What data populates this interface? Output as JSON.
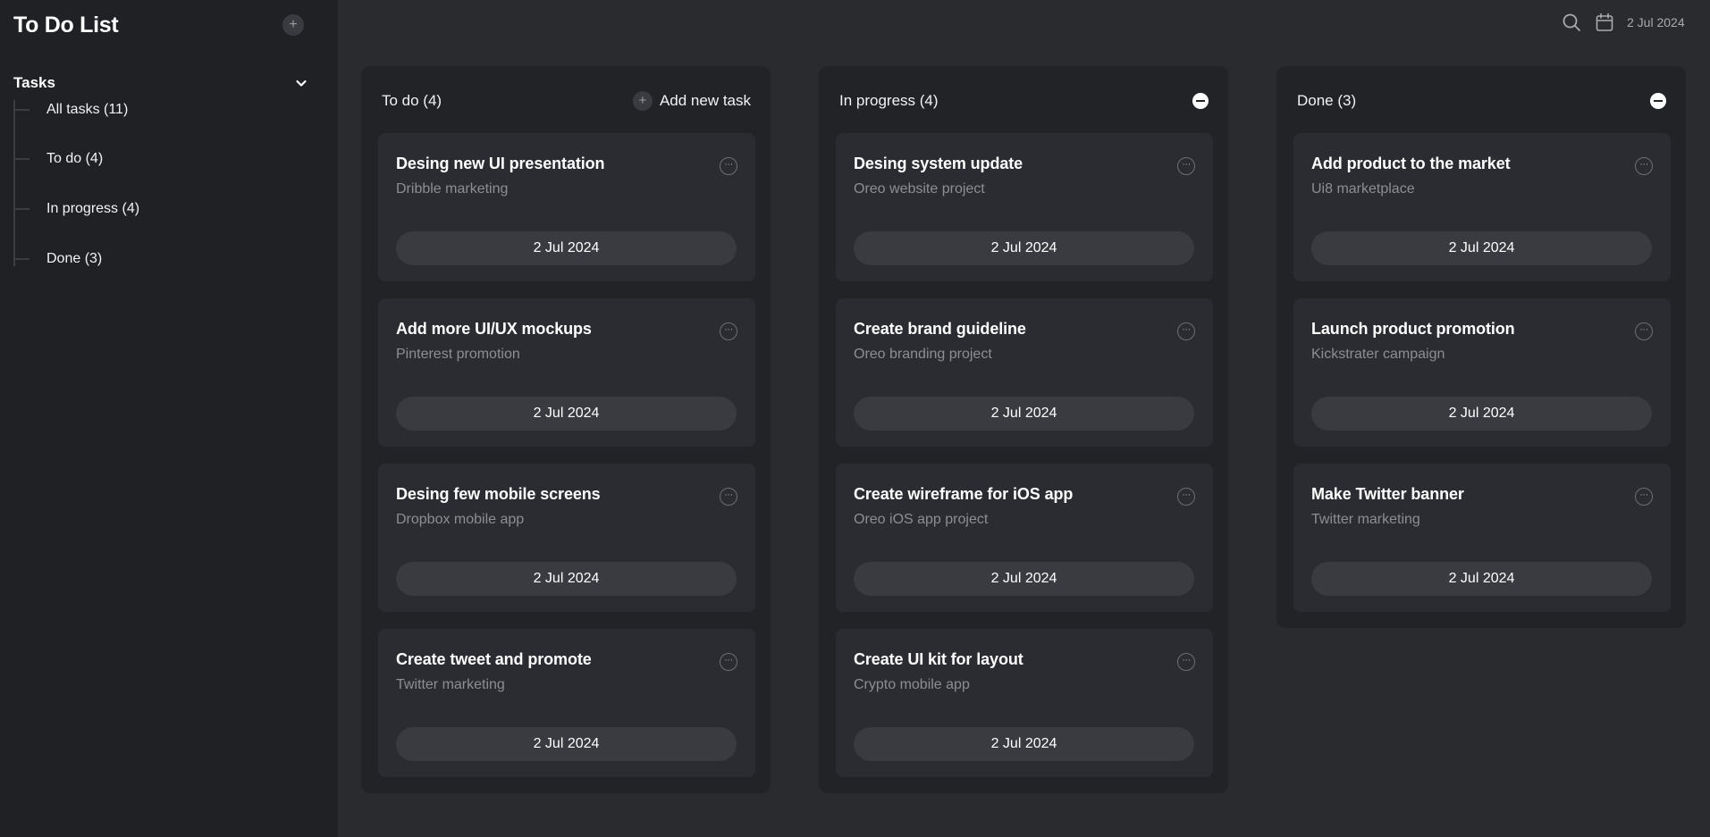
{
  "app": {
    "title": "To Do List",
    "add_icon": "+"
  },
  "sidebar": {
    "section_label": "Tasks",
    "items": [
      {
        "label": "All tasks (11)"
      },
      {
        "label": "To do (4)"
      },
      {
        "label": "In progress (4)"
      },
      {
        "label": "Done (3)"
      }
    ]
  },
  "topbar": {
    "date": "2 Jul 2024"
  },
  "columns": [
    {
      "title": "To do (4)",
      "action_label": "Add new task",
      "cards": [
        {
          "title": "Desing new UI presentation",
          "subtitle": "Dribble marketing",
          "date": "2 Jul 2024"
        },
        {
          "title": "Add more UI/UX mockups",
          "subtitle": "Pinterest promotion",
          "date": "2 Jul 2024"
        },
        {
          "title": "Desing few mobile screens",
          "subtitle": "Dropbox mobile app",
          "date": "2 Jul 2024"
        },
        {
          "title": "Create tweet and promote",
          "subtitle": "Twitter marketing",
          "date": "2 Jul 2024"
        }
      ]
    },
    {
      "title": "In progress (4)",
      "cards": [
        {
          "title": "Desing system update",
          "subtitle": "Oreo website project",
          "date": "2 Jul 2024"
        },
        {
          "title": "Create brand guideline",
          "subtitle": "Oreo branding project",
          "date": "2 Jul 2024"
        },
        {
          "title": "Create wireframe for iOS app",
          "subtitle": "Oreo iOS app project",
          "date": "2 Jul 2024"
        },
        {
          "title": "Create UI kit for layout",
          "subtitle": "Crypto mobile app",
          "date": "2 Jul 2024"
        }
      ]
    },
    {
      "title": "Done (3)",
      "cards": [
        {
          "title": "Add product to the market",
          "subtitle": "Ui8 marketplace",
          "date": "2 Jul 2024"
        },
        {
          "title": "Launch product promotion",
          "subtitle": "Kickstrater campaign",
          "date": "2 Jul 2024"
        },
        {
          "title": "Make Twitter banner",
          "subtitle": "Twitter marketing",
          "date": "2 Jul 2024"
        }
      ]
    }
  ],
  "icons": {
    "more": "···",
    "search": "search-icon",
    "calendar": "calendar-icon",
    "chevron": "chevron-down-icon",
    "collapse": "minus-circle-icon"
  },
  "colors": {
    "background": "#2a2b2f",
    "sidebar": "#202125",
    "column": "#222327",
    "card": "#2b2c31",
    "pill": "#3a3b40",
    "subtitle": "#8d8e94"
  }
}
